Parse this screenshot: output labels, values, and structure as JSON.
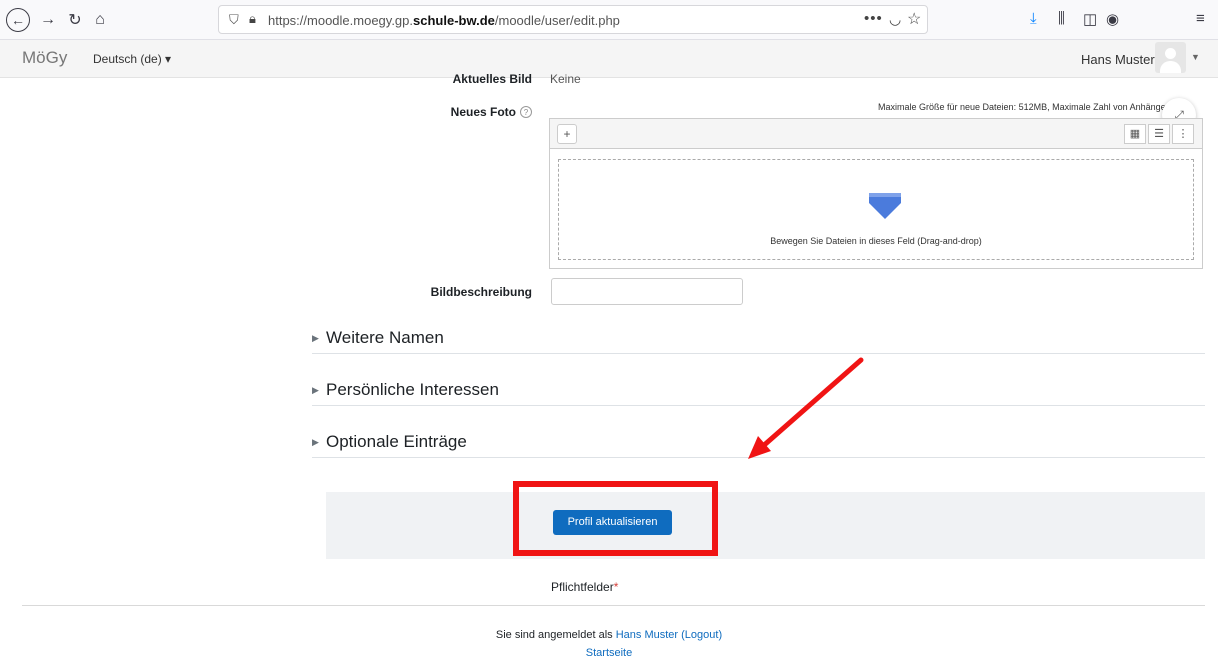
{
  "browser": {
    "url_prefix": "https://moodle.moegy.gp.",
    "url_domain": "schule-bw.de",
    "url_path": "/moodle/user/edit.php",
    "more_glyph": "•••"
  },
  "navbar": {
    "brand": "MöGy",
    "language": "Deutsch (de) ▾",
    "user_name": "Hans Muster"
  },
  "form": {
    "current_picture_label": "Aktuelles Bild",
    "current_picture_value": "Keine",
    "new_photo_label": "Neues Foto",
    "file_limits": "Maximale Größe für neue Dateien: 512MB, Maximale Zahl von Anhängen: 1",
    "drop_hint": "Bewegen Sie Dateien in dieses Feld (Drag-and-drop)",
    "image_description_label": "Bildbeschreibung",
    "image_description_value": ""
  },
  "sections": [
    {
      "title": "Weitere Namen"
    },
    {
      "title": "Persönliche Interessen"
    },
    {
      "title": "Optionale Einträge"
    }
  ],
  "submit_label": "Profil aktualisieren",
  "required_label": "Pflichtfelder",
  "required_star": "*",
  "footer": {
    "logged_in_as": "Sie sind angemeldet als",
    "user_link": "Hans Muster",
    "logout_link": "(Logout)",
    "home_link": "Startseite"
  },
  "colors": {
    "accent": "#0f6cbf",
    "annotation": "#f01414"
  }
}
